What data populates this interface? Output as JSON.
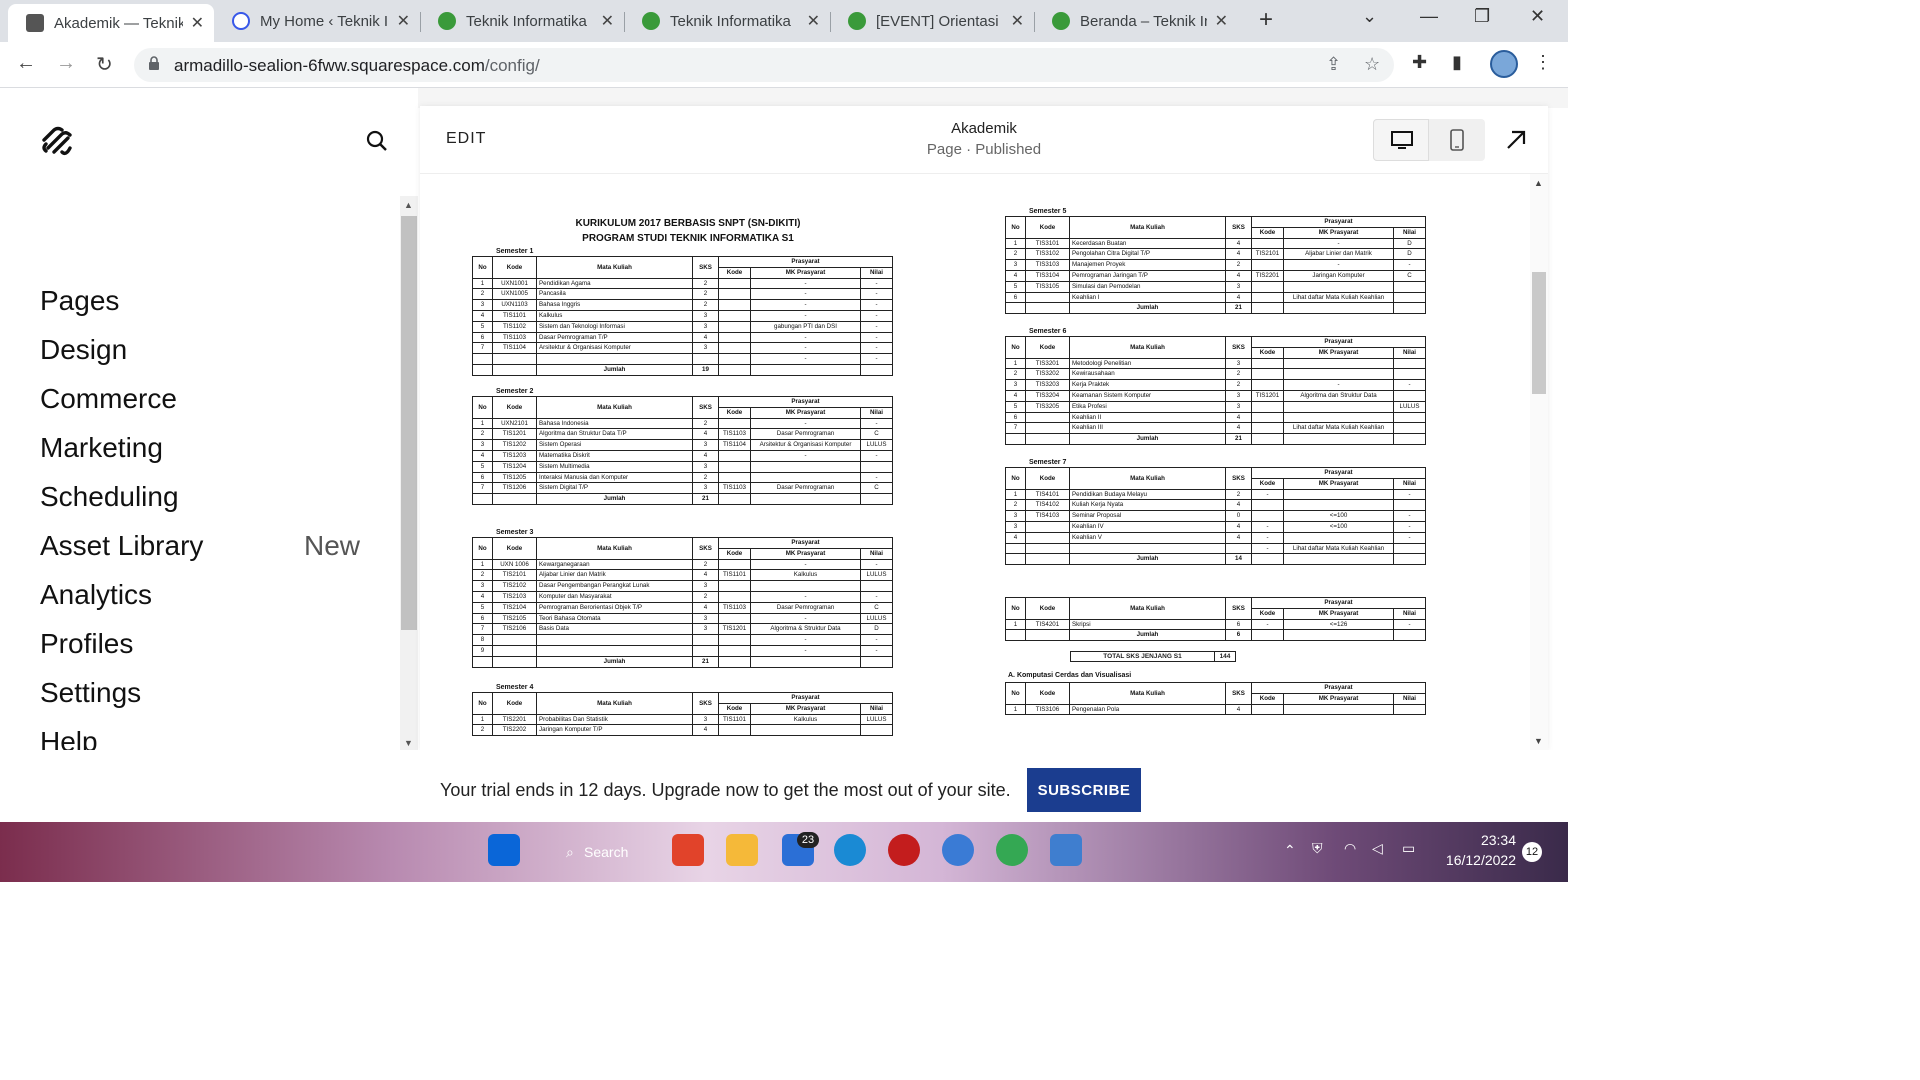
{
  "browser": {
    "tabs": [
      {
        "title": "Akademik — Teknik I",
        "active": true
      },
      {
        "title": "My Home ‹ Teknik I",
        "active": false
      },
      {
        "title": "Teknik Informatika",
        "active": false
      },
      {
        "title": "Teknik Informatika",
        "active": false
      },
      {
        "title": "[EVENT] Orientasi P",
        "active": false
      },
      {
        "title": "Beranda – Teknik In",
        "active": false
      }
    ],
    "url_domain": "armadillo-sealion-6fww.squarespace.com",
    "url_path": "/config/"
  },
  "sidebar": {
    "items": [
      {
        "label": "Pages",
        "badge": ""
      },
      {
        "label": "Design",
        "badge": ""
      },
      {
        "label": "Commerce",
        "badge": ""
      },
      {
        "label": "Marketing",
        "badge": ""
      },
      {
        "label": "Scheduling",
        "badge": ""
      },
      {
        "label": "Asset Library",
        "badge": "New"
      },
      {
        "label": "Analytics",
        "badge": ""
      },
      {
        "label": "Profiles",
        "badge": ""
      },
      {
        "label": "Settings",
        "badge": ""
      },
      {
        "label": "Help",
        "badge": ""
      }
    ]
  },
  "editor": {
    "edit_label": "EDIT",
    "page_title": "Akademik",
    "page_status": "Page · Published"
  },
  "document": {
    "title_line1": "KURIKULUM 2017 BERBASIS SNPT (SN-DIKITI)",
    "title_line2": "PROGRAM STUDI TEKNIK INFORMATIKA S1",
    "headers": {
      "no": "No",
      "kode": "Kode",
      "mk": "Mata Kuliah",
      "sks": "SKS",
      "prasyarat": "Prasyarat",
      "p_kode": "Kode",
      "p_mk": "MK Prasyarat",
      "p_nilai": "Nilai"
    },
    "jumlah_label": "Jumlah",
    "semesters": [
      {
        "label": "Semester 1",
        "rows": [
          [
            "1",
            "UXN1001",
            "Pendidikan Agama",
            "2",
            "",
            "-",
            "-"
          ],
          [
            "2",
            "UXN1005",
            "Pancasila",
            "2",
            "",
            "-",
            "-"
          ],
          [
            "3",
            "UXN1103",
            "Bahasa Inggris",
            "2",
            "",
            "-",
            "-"
          ],
          [
            "4",
            "TIS1101",
            "Kalkulus",
            "3",
            "",
            "-",
            "-"
          ],
          [
            "5",
            "TIS1102",
            "Sistem dan Teknologi Informasi",
            "3",
            "",
            "gabungan PTI dan DSI",
            "-"
          ],
          [
            "6",
            "TIS1103",
            "Dasar Pemrograman T/P",
            "4",
            "",
            "-",
            "-"
          ],
          [
            "7",
            "TIS1104",
            "Arsitektur & Organisasi Komputer",
            "3",
            "",
            "-",
            "-"
          ],
          [
            "",
            "",
            "",
            "",
            "",
            "-",
            "-"
          ]
        ],
        "total": "19"
      },
      {
        "label": "Semester 2",
        "rows": [
          [
            "1",
            "UXN2101",
            "Bahasa Indonesia",
            "2",
            "",
            "-",
            "-"
          ],
          [
            "2",
            "TIS1201",
            "Algoritma dan Struktur Data T/P",
            "4",
            "TIS1103",
            "Dasar Pemrograman",
            "C"
          ],
          [
            "3",
            "TIS1202",
            "Sistem Operasi",
            "3",
            "TIS1104",
            "Arsitektur & Organisasi Komputer",
            "LULUS"
          ],
          [
            "4",
            "TIS1203",
            "Matematika Diskrit",
            "4",
            "",
            "-",
            "-"
          ],
          [
            "5",
            "TIS1204",
            "Sistem Multimedia",
            "3",
            "",
            "",
            ""
          ],
          [
            "6",
            "TIS1205",
            "Interaksi Manusia dan Komputer",
            "2",
            "",
            "",
            "-"
          ],
          [
            "7",
            "TIS1206",
            "Sistem Digital T/P",
            "3",
            "TIS1103",
            "Dasar Pemrograman",
            "C"
          ]
        ],
        "total": "21"
      },
      {
        "label": "Semester 3",
        "rows": [
          [
            "1",
            "UXN 1006",
            "Kewarganegaraan",
            "2",
            "",
            "-",
            "-"
          ],
          [
            "2",
            "TIS2101",
            "Aljabar Linier dan Matrik",
            "4",
            "TIS1101",
            "Kalkulus",
            "LULUS"
          ],
          [
            "3",
            "TIS2102",
            "Dasar Pengembangan Perangkat Lunak",
            "3",
            "",
            "",
            ""
          ],
          [
            "4",
            "TIS2103",
            "Komputer dan Masyarakat",
            "2",
            "",
            "-",
            "-"
          ],
          [
            "5",
            "TIS2104",
            "Pemrograman Berorientasi Objek T/P",
            "4",
            "TIS1103",
            "Dasar Pemrograman",
            "C"
          ],
          [
            "6",
            "TIS2105",
            "Teori Bahasa Otomata",
            "3",
            "",
            "-",
            "LULUS"
          ],
          [
            "7",
            "TIS2106",
            "Basis Data",
            "3",
            "TIS1201",
            "Algoritma & Struktur Data",
            "D"
          ],
          [
            "8",
            "",
            "",
            "",
            "",
            "-",
            "-"
          ],
          [
            "9",
            "",
            "",
            "",
            "",
            "-",
            "-"
          ]
        ],
        "total": "21"
      },
      {
        "label": "Semester 4",
        "rows": [
          [
            "1",
            "TIS2201",
            "Probabilitas Dan Statistik",
            "3",
            "TIS1101",
            "Kalkulus",
            "LULUS"
          ],
          [
            "2",
            "TIS2202",
            "Jaringan Komputer T/P",
            "4",
            "",
            "",
            ""
          ]
        ],
        "total": ""
      },
      {
        "label": "Semester 5",
        "rows": [
          [
            "1",
            "TIS3101",
            "Kecerdasan Buatan",
            "4",
            "",
            "-",
            "D"
          ],
          [
            "2",
            "TIS3102",
            "Pengolahan Citra Digital T/P",
            "4",
            "TIS2101",
            "Aljabar Linier dan Matrik",
            "D"
          ],
          [
            "3",
            "TIS3103",
            "Manajemen Proyek",
            "2",
            "",
            "-",
            "-"
          ],
          [
            "4",
            "TIS3104",
            "Pemrograman Jaringan T/P",
            "4",
            "TIS2201",
            "Jaringan Komputer",
            "C"
          ],
          [
            "5",
            "TIS3105",
            "Simulasi dan Pemodelan",
            "3",
            "",
            "",
            ""
          ],
          [
            "6",
            "",
            "Keahlian I",
            "4",
            "",
            "Lihat daftar Mata Kuliah Keahlian",
            ""
          ]
        ],
        "total": "21"
      },
      {
        "label": "Semester 6",
        "rows": [
          [
            "1",
            "TIS3201",
            "Metodologi Penelitian",
            "3",
            "",
            "",
            ""
          ],
          [
            "2",
            "TIS3202",
            "Kewirausahaan",
            "2",
            "",
            "",
            ""
          ],
          [
            "3",
            "TIS3203",
            "Kerja Praktek",
            "2",
            "",
            "-",
            "-"
          ],
          [
            "4",
            "TIS3204",
            "Keamanan Sistem Komputer",
            "3",
            "TIS1201",
            "Algoritma dan Struktur Data",
            ""
          ],
          [
            "5",
            "TIS3205",
            "Etika Profesi",
            "3",
            "",
            "",
            "LULUS"
          ],
          [
            "6",
            "",
            "Keahlian II",
            "4",
            "",
            "",
            ""
          ],
          [
            "7",
            "",
            "Keahlian III",
            "4",
            "",
            "Lihat daftar Mata Kuliah Keahlian",
            ""
          ]
        ],
        "total": "21"
      },
      {
        "label": "Semester 7",
        "rows": [
          [
            "1",
            "TIS4101",
            "Pendidikan Budaya Melayu",
            "2",
            "-",
            "",
            "-"
          ],
          [
            "2",
            "TIS4102",
            "Kuliah Kerja Nyata",
            "4",
            "",
            "",
            ""
          ],
          [
            "3",
            "TIS4103",
            "Seminar Proposal",
            "0",
            "",
            "<=100",
            "-"
          ],
          [
            "3",
            "",
            "Keahlian IV",
            "4",
            "-",
            "<=100",
            "-"
          ],
          [
            "4",
            "",
            "Keahlian V",
            "4",
            "-",
            "",
            "-"
          ],
          [
            "",
            "",
            "",
            "",
            "-",
            "Lihat daftar Mata Kuliah Keahlian",
            ""
          ]
        ],
        "total": "14"
      },
      {
        "label": "",
        "rows": [
          [
            "1",
            "TIS4201",
            "Skripsi",
            "6",
            "-",
            "<=126",
            "-"
          ]
        ],
        "total": "6"
      }
    ],
    "total_label": "TOTAL SKS JENJANG S1",
    "total_value": "144",
    "section_a": "A. Komputasi Cerdas dan Visualisasi",
    "section_a_rows": [
      [
        "1",
        "TIS3106",
        "Pengenalan Pola",
        "4",
        "",
        "",
        ""
      ]
    ]
  },
  "trial": {
    "message": "Your trial ends in 12 days. Upgrade now to get the most out of your site.",
    "button": "SUBSCRIBE"
  },
  "taskbar": {
    "search_label": "Search",
    "mail_badge": "23",
    "time": "23:34",
    "date": "16/12/2022",
    "notifications": "12"
  },
  "colors": {
    "accent": "#1b3d8f",
    "tabbar": "#dee1e6"
  }
}
